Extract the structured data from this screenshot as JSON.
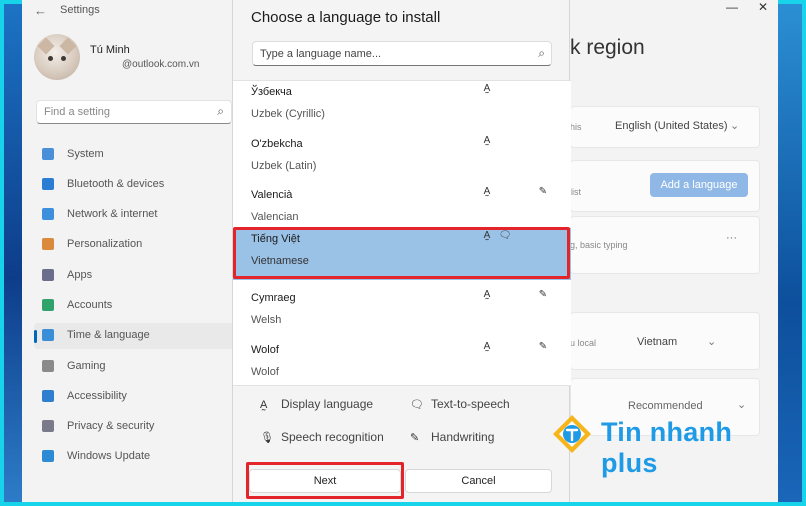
{
  "settings": {
    "window_title": "Settings",
    "back_glyph": "←",
    "minimize_glyph": "—",
    "close_glyph": "✕",
    "profile": {
      "name": "Tú Minh",
      "email": "@outlook.com.vn"
    },
    "find_placeholder": "Find a setting",
    "nav": [
      {
        "label": "System",
        "icon": "monitor-icon",
        "color": "#4a90d9"
      },
      {
        "label": "Bluetooth & devices",
        "icon": "bluetooth-icon",
        "color": "#2b7cd3"
      },
      {
        "label": "Network & internet",
        "icon": "wifi-icon",
        "color": "#3d8fde"
      },
      {
        "label": "Personalization",
        "icon": "brush-icon",
        "color": "#d98a3c"
      },
      {
        "label": "Apps",
        "icon": "apps-icon",
        "color": "#6c6c8c"
      },
      {
        "label": "Accounts",
        "icon": "person-icon",
        "color": "#2fa36b"
      },
      {
        "label": "Time & language",
        "icon": "globe-clock-icon",
        "color": "#3a8ed8"
      },
      {
        "label": "Gaming",
        "icon": "gamepad-icon",
        "color": "#8a8a8a"
      },
      {
        "label": "Accessibility",
        "icon": "accessibility-icon",
        "color": "#2f7fd0"
      },
      {
        "label": "Privacy & security",
        "icon": "shield-icon",
        "color": "#7a7a8a"
      },
      {
        "label": "Windows Update",
        "icon": "update-icon",
        "color": "#2d8bd6"
      }
    ],
    "right_pane": {
      "title_fragment": "k region",
      "display_lang_fragment": "his",
      "display_lang_value": "English (United States)",
      "preferred_fragment": "list",
      "add_language_label": "Add a language",
      "typing_fragment": "g, basic typing",
      "more_glyph": "···",
      "region_fragment": "u local",
      "region_value": "Vietnam",
      "format_value": "Recommended"
    }
  },
  "dialog": {
    "title": "Choose a language to install",
    "search_placeholder": "Type a language name...",
    "languages": [
      {
        "native": "Ўзбекча",
        "english": "Uzbek (Cyrillic)",
        "features": [
          "display-language"
        ],
        "selected": false
      },
      {
        "native": "O'zbekcha",
        "english": "Uzbek (Latin)",
        "features": [
          "display-language"
        ],
        "selected": false
      },
      {
        "native": "Valencià",
        "english": "Valencian",
        "features": [
          "display-language",
          "handwriting"
        ],
        "selected": false
      },
      {
        "native": "Tiếng Việt",
        "english": "Vietnamese",
        "features": [
          "display-language",
          "text-to-speech"
        ],
        "selected": true
      },
      {
        "native": "Cymraeg",
        "english": "Welsh",
        "features": [
          "display-language",
          "handwriting"
        ],
        "selected": false
      },
      {
        "native": "Wolof",
        "english": "Wolof",
        "features": [
          "display-language",
          "handwriting"
        ],
        "selected": false
      }
    ],
    "legend": {
      "display_language": "Display language",
      "text_to_speech": "Text-to-speech",
      "speech_recognition": "Speech recognition",
      "handwriting": "Handwriting"
    },
    "next_label": "Next",
    "cancel_label": "Cancel"
  },
  "watermark": {
    "text": "Tin nhanh plus",
    "color": "#1e9ae6"
  },
  "colors": {
    "selection": "#9ac1e6",
    "highlight": "#e3242b",
    "accent": "#0067c0"
  }
}
